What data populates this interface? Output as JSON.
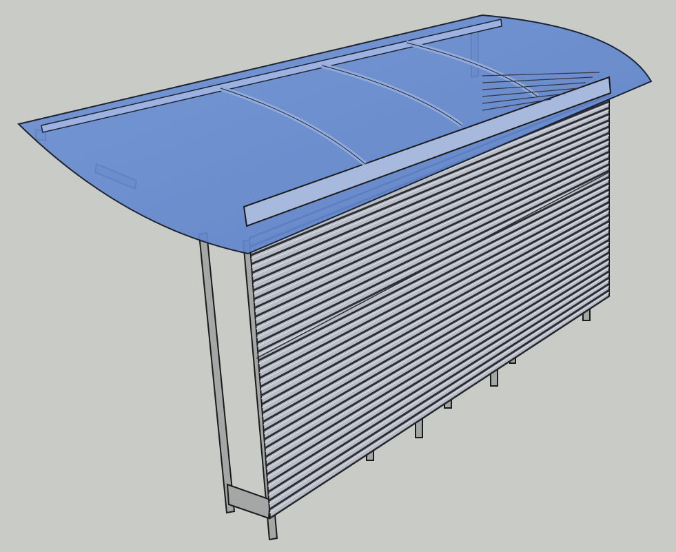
{
  "app": {
    "title": ""
  },
  "scene": {
    "background_color": "#c9cbc7",
    "subject": "bicycle-shelter-with-curved-roof",
    "colors": {
      "roof_fill": "#6f93d4",
      "roof_edge": "#1c2433",
      "wall_panel": "#b9bdc6",
      "wall_panel_shadow": "#2b2e33",
      "frame": "#a5a6a6",
      "frame_dark": "#6b6d70",
      "outline": "#1a1a1a"
    }
  }
}
